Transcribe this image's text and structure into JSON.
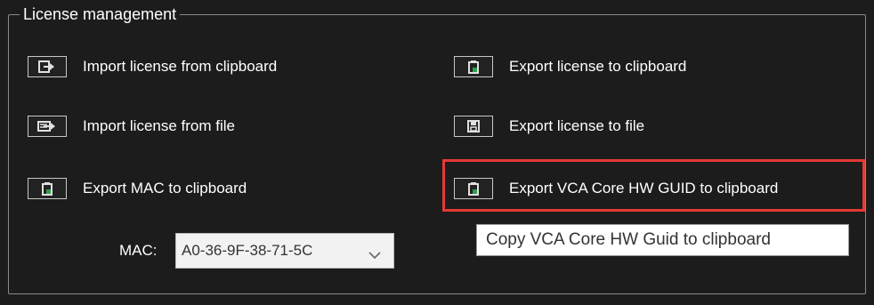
{
  "group": {
    "title": "License management"
  },
  "actions": {
    "import_clipboard": {
      "label": "Import license from clipboard",
      "icon": "import-arrow-icon"
    },
    "import_file": {
      "label": "Import license from file",
      "icon": "import-file-icon"
    },
    "export_mac": {
      "label": "Export MAC to clipboard",
      "icon": "clipboard-icon"
    },
    "export_clipboard": {
      "label": "Export license to clipboard",
      "icon": "clipboard-icon"
    },
    "export_file": {
      "label": "Export license to file",
      "icon": "save-disk-icon"
    },
    "export_guid": {
      "label": "Export VCA Core HW GUID to clipboard",
      "icon": "clipboard-icon"
    }
  },
  "mac": {
    "label": "MAC:",
    "selected": "A0-36-9F-38-71-5C"
  },
  "tooltip": {
    "text": "Copy VCA Core HW Guid to clipboard"
  },
  "colors": {
    "background": "#1c1c1c",
    "highlight": "#e53935",
    "icon_accent": "#2e9e4a"
  }
}
